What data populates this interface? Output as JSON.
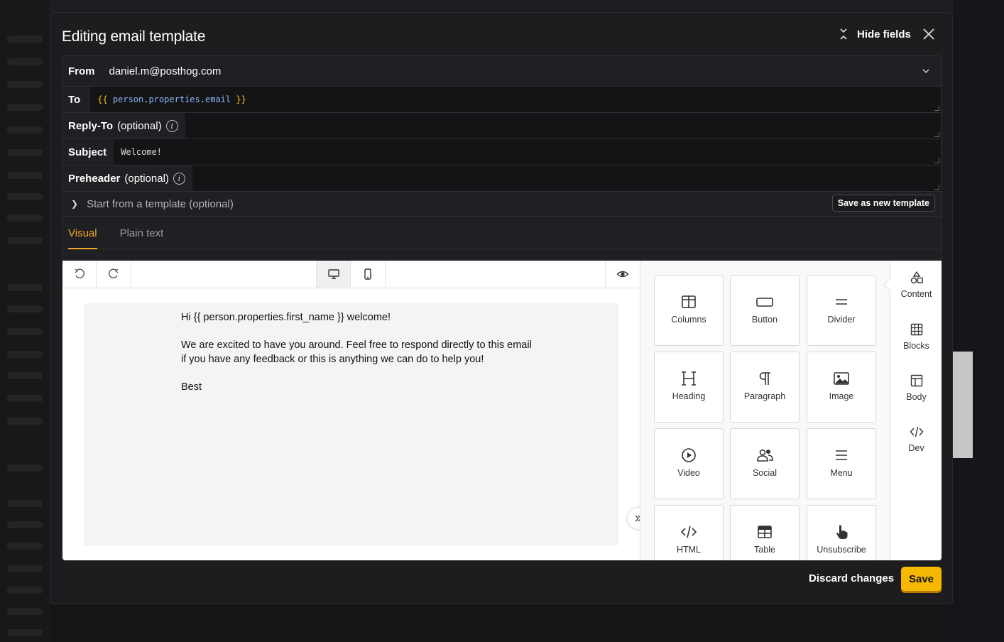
{
  "modal": {
    "title": "Editing email template",
    "hide_fields_label": "Hide fields"
  },
  "fields": {
    "from_label": "From",
    "from_value": "daniel.m@posthog.com",
    "to_label": "To",
    "to_value": {
      "open": "{{",
      "var": "person",
      "dot1": ".",
      "prop": "properties",
      "dot2": ".",
      "field": "email",
      "close": "}}"
    },
    "reply_to_label": "Reply-To",
    "reply_to_optional": "(optional)",
    "subject_label": "Subject",
    "subject_value": "Welcome!",
    "preheader_label": "Preheader",
    "preheader_optional": "(optional)",
    "template_label": "Start from a template (optional)",
    "save_template_label": "Save as new template"
  },
  "tabs": [
    {
      "label": "Visual",
      "active": true
    },
    {
      "label": "Plain text",
      "active": false
    }
  ],
  "email_body": {
    "greeting": "Hi {{ person.properties.first_name }} welcome!",
    "paragraph": "We are excited to have you around. Feel free to respond directly to this email if you have any feedback or this is anything we can do to help you!",
    "signoff": "Best"
  },
  "content_tiles": [
    {
      "label": "Columns",
      "icon": "columns-icon"
    },
    {
      "label": "Button",
      "icon": "button-icon"
    },
    {
      "label": "Divider",
      "icon": "divider-icon"
    },
    {
      "label": "Heading",
      "icon": "heading-icon"
    },
    {
      "label": "Paragraph",
      "icon": "paragraph-icon"
    },
    {
      "label": "Image",
      "icon": "image-icon"
    },
    {
      "label": "Video",
      "icon": "video-icon"
    },
    {
      "label": "Social",
      "icon": "social-icon"
    },
    {
      "label": "Menu",
      "icon": "menu-icon"
    },
    {
      "label": "HTML",
      "icon": "code-icon"
    },
    {
      "label": "Table",
      "icon": "table-icon"
    },
    {
      "label": "Unsubscribe",
      "icon": "pointer-icon"
    }
  ],
  "rail": [
    {
      "label": "Content",
      "icon": "shapes-icon"
    },
    {
      "label": "Blocks",
      "icon": "blocks-icon"
    },
    {
      "label": "Body",
      "icon": "body-icon"
    },
    {
      "label": "Dev",
      "icon": "code-icon"
    }
  ],
  "footer": {
    "discard_label": "Discard changes",
    "save_label": "Save"
  },
  "colors": {
    "accent": "#f5a623",
    "save_button": "#f7b900",
    "modal_bg": "#1d1d20"
  }
}
